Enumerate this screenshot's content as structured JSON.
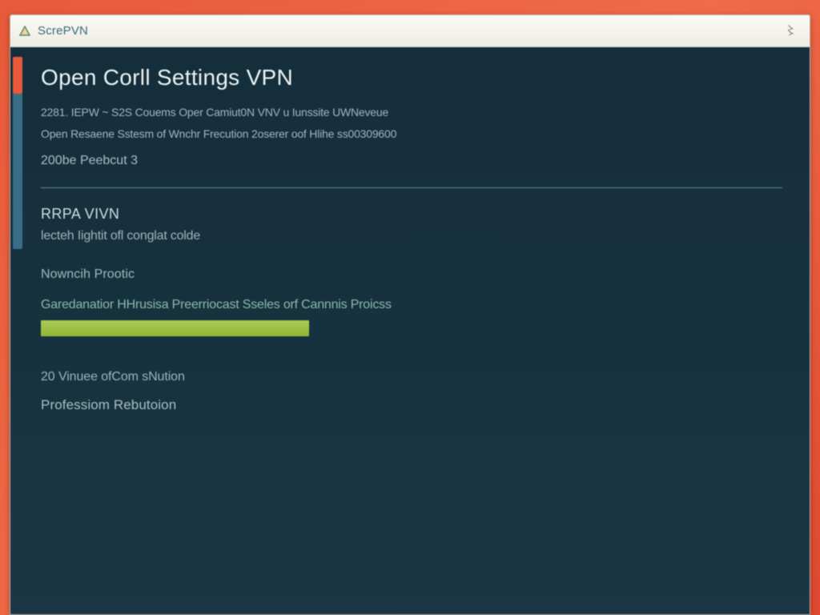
{
  "titlebar": {
    "app_name": "ScrePVN",
    "right_glyph": "〻"
  },
  "page": {
    "heading": "Open Corll Settings VPN",
    "detail_line1": "2281. IEPW ~ S2S Couems Oper Camiut0N VNV u Iunssite UWNeveue",
    "detail_line2": "Open Resaene Sstesm of Wnchr Frecution 2oserer oof Hlihe ss00309600",
    "status_line": "200be Peebcut 3"
  },
  "section": {
    "title": "RRPA VIVN",
    "description": "lecteh Iightit ofl conglat colde",
    "group_label": "Nowncih Prootic",
    "link_text": "Garedanatior HHrusisa Preerriocast Sseles orf Cannnis Proicss"
  },
  "footer": {
    "line1": "20 Vinuee ofCom sNution",
    "line2": "Professiom Rebutoion"
  },
  "colors": {
    "bezel": "#e85a3a",
    "panel": "#16303e",
    "accent_green": "#9bbf3f",
    "scroll_accent": "#e85a3a"
  }
}
